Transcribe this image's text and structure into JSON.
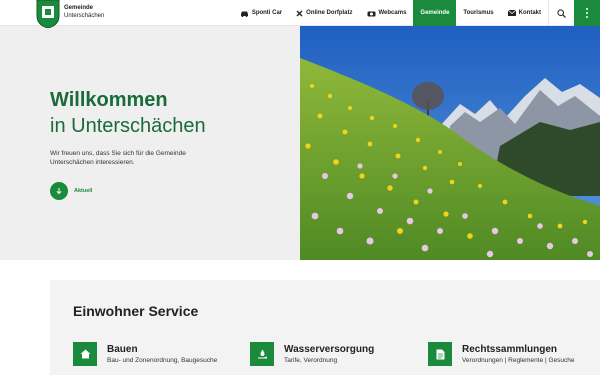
{
  "header": {
    "brand_line1": "Gemeinde",
    "brand_line2": "Unterschächen",
    "nav": [
      {
        "label": "Sponti Car",
        "icon": "car-icon"
      },
      {
        "label": "Online Dorfplatz",
        "icon": "tools-icon"
      },
      {
        "label": "Webcams",
        "icon": "webcam-icon"
      },
      {
        "label": "Gemeinde",
        "icon": null,
        "active": true
      },
      {
        "label": "Tourismus",
        "icon": null
      },
      {
        "label": "Kontakt",
        "icon": "envelope-icon"
      }
    ],
    "accent_color": "#1a8a3c"
  },
  "hero": {
    "title": "Willkommen",
    "subtitle": "in Unterschächen",
    "text": "Wir freuen uns, dass Sie sich für die Gemeinde Unterschächen interessieren.",
    "button_label": "Aktuell"
  },
  "service": {
    "title": "Einwohner Service",
    "items": [
      {
        "title": "Bauen",
        "desc": "Bau- und Zonenordnung, Baugesuche",
        "icon": "house-icon"
      },
      {
        "title": "Wasserversorgung",
        "desc": "Tarife, Verordnung",
        "icon": "water-hand-icon"
      },
      {
        "title": "Rechtssammlungen",
        "desc": "Verordnungen | Reglemente | Gesuche",
        "icon": "document-icon"
      }
    ]
  }
}
